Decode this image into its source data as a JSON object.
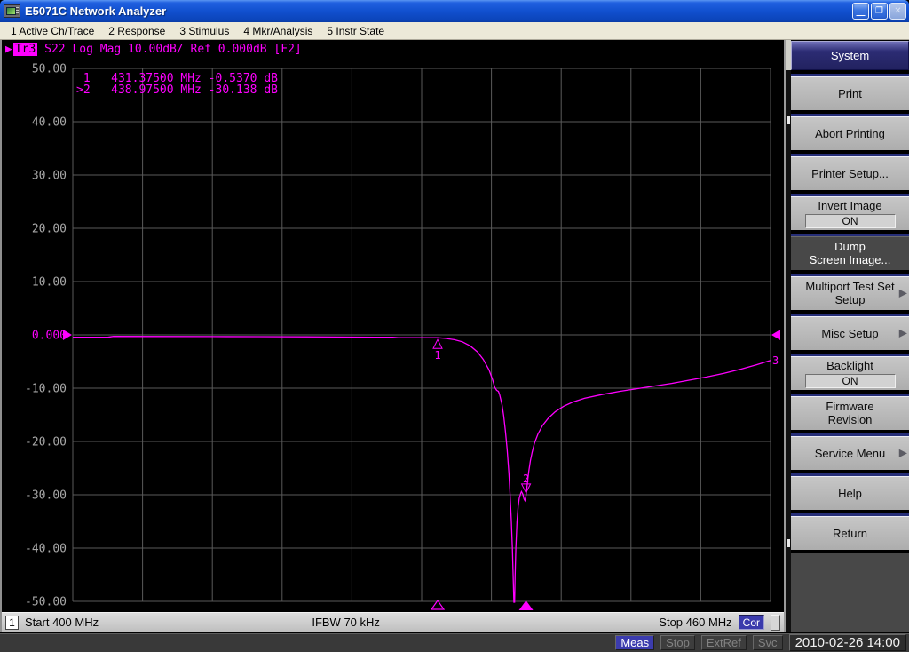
{
  "window": {
    "title": "E5071C Network Analyzer",
    "controls": {
      "minimize": "—",
      "restore": "❐",
      "close": "✕"
    }
  },
  "menu": {
    "items": [
      "1 Active Ch/Trace",
      "2 Response",
      "3 Stimulus",
      "4 Mkr/Analysis",
      "5 Instr State"
    ]
  },
  "trace_info": {
    "active_indicator": "▶",
    "trace_chip": "Tr3",
    "text": " S22 Log Mag 10.00dB/ Ref 0.000dB [F2]"
  },
  "marker_readout": {
    "rows": [
      " 1   431.37500 MHz -0.5370 dB",
      ">2   438.97500 MHz -30.138 dB"
    ]
  },
  "status_strip": {
    "channel": "1",
    "start": "Start 400 MHz",
    "ifbw": "IFBW 70 kHz",
    "stop": "Stop 460 MHz",
    "cor": "Cor"
  },
  "sidebar": {
    "title": "System",
    "buttons": [
      {
        "lines": [
          "Print"
        ]
      },
      {
        "lines": [
          "Abort Printing"
        ]
      },
      {
        "lines": [
          "Printer Setup..."
        ]
      },
      {
        "lines": [
          "Invert Image"
        ],
        "toggle": "ON"
      },
      {
        "lines": [
          "Dump",
          "Screen Image..."
        ],
        "pressed": true
      },
      {
        "lines": [
          "Multiport Test Set",
          "Setup"
        ],
        "arrow": "▶"
      },
      {
        "lines": [
          "Misc Setup"
        ],
        "arrow": "▶"
      },
      {
        "lines": [
          "Backlight"
        ],
        "toggle": "ON"
      },
      {
        "lines": [
          "Firmware",
          "Revision"
        ]
      },
      {
        "lines": [
          "Service Menu"
        ],
        "arrow": "▶"
      },
      {
        "lines": [
          "Help"
        ]
      },
      {
        "lines": [
          "Return"
        ]
      }
    ]
  },
  "statusbar": {
    "segments": [
      {
        "label": "Meas",
        "state": "active"
      },
      {
        "label": "Stop",
        "state": "dim"
      },
      {
        "label": "ExtRef",
        "state": "dim"
      },
      {
        "label": "Svc",
        "state": "dim"
      }
    ],
    "clock": "2010-02-26 14:00"
  },
  "chart_data": {
    "type": "line",
    "title": "Tr3 S22 Log Mag 10.00dB/ Ref 0.000dB [F2]",
    "x_start_mhz": 400,
    "x_stop_mhz": 460,
    "y_top_db": 50,
    "y_bottom_db": -50,
    "y_scale_per_div_db": 10,
    "x_divisions": 10,
    "y_divisions": 10,
    "grid": true,
    "y_tick_labels": [
      "50.00",
      "40.00",
      "30.00",
      "20.00",
      "10.00",
      "0.000",
      "-10.00",
      "-20.00",
      "-30.00",
      "-40.00",
      "-50.00"
    ],
    "reference_level_db": 0,
    "reference_tick_index": 5,
    "trace_color": "#ff00ff",
    "grid_color": "#5a5a5a",
    "tick_label_color": "#a8a8a8",
    "trace_number_label": "3",
    "markers": [
      {
        "id": "1",
        "freq_mhz": 431.375,
        "db": -0.537,
        "active": false
      },
      {
        "id": "2",
        "freq_mhz": 438.975,
        "db": -30.138,
        "active": true
      }
    ],
    "series": [
      {
        "name": "Tr3 S22 Log Mag",
        "points": [
          [
            400.0,
            -0.45
          ],
          [
            403.0,
            -0.45
          ],
          [
            403.5,
            -0.28
          ],
          [
            408.0,
            -0.3
          ],
          [
            412.0,
            -0.32
          ],
          [
            416.0,
            -0.34
          ],
          [
            420.0,
            -0.37
          ],
          [
            423.0,
            -0.4
          ],
          [
            426.0,
            -0.44
          ],
          [
            427.5,
            -0.45
          ],
          [
            428.0,
            -0.52
          ],
          [
            430.0,
            -0.52
          ],
          [
            431.375,
            -0.537
          ],
          [
            432.0,
            -0.65
          ],
          [
            432.8,
            -0.9
          ],
          [
            433.5,
            -1.3
          ],
          [
            434.2,
            -2.1
          ],
          [
            434.8,
            -3.2
          ],
          [
            435.3,
            -4.6
          ],
          [
            435.8,
            -6.6
          ],
          [
            436.1,
            -8.4
          ],
          [
            436.3,
            -9.9
          ],
          [
            436.45,
            -10.4
          ],
          [
            436.6,
            -10.6
          ],
          [
            436.7,
            -11.2
          ],
          [
            436.9,
            -13.0
          ],
          [
            437.05,
            -15.2
          ],
          [
            437.2,
            -18.0
          ],
          [
            437.35,
            -21.5
          ],
          [
            437.5,
            -26.0
          ],
          [
            437.6,
            -30.0
          ],
          [
            437.7,
            -34.5
          ],
          [
            437.8,
            -40.0
          ],
          [
            437.88,
            -46.0
          ],
          [
            437.93,
            -50.5
          ],
          [
            437.99,
            -50.5
          ],
          [
            438.04,
            -45.0
          ],
          [
            438.1,
            -40.0
          ],
          [
            438.2,
            -35.0
          ],
          [
            438.3,
            -32.2
          ],
          [
            438.4,
            -30.6
          ],
          [
            438.5,
            -29.8
          ],
          [
            438.58,
            -29.4
          ],
          [
            438.7,
            -29.9
          ],
          [
            438.8,
            -30.8
          ],
          [
            438.88,
            -31.1
          ],
          [
            438.975,
            -30.138
          ],
          [
            439.05,
            -28.6
          ],
          [
            439.2,
            -25.8
          ],
          [
            439.35,
            -23.6
          ],
          [
            439.5,
            -22.0
          ],
          [
            439.7,
            -20.3
          ],
          [
            440.0,
            -18.6
          ],
          [
            440.4,
            -17.0
          ],
          [
            440.9,
            -15.6
          ],
          [
            441.5,
            -14.4
          ],
          [
            442.2,
            -13.4
          ],
          [
            443.0,
            -12.6
          ],
          [
            444.0,
            -11.9
          ],
          [
            445.5,
            -11.2
          ],
          [
            447.0,
            -10.6
          ],
          [
            448.5,
            -10.1
          ],
          [
            450.0,
            -9.6
          ],
          [
            451.5,
            -9.1
          ],
          [
            453.0,
            -8.5
          ],
          [
            454.5,
            -7.9
          ],
          [
            456.0,
            -7.2
          ],
          [
            457.5,
            -6.4
          ],
          [
            458.8,
            -5.6
          ],
          [
            460.0,
            -4.8
          ]
        ]
      }
    ]
  }
}
